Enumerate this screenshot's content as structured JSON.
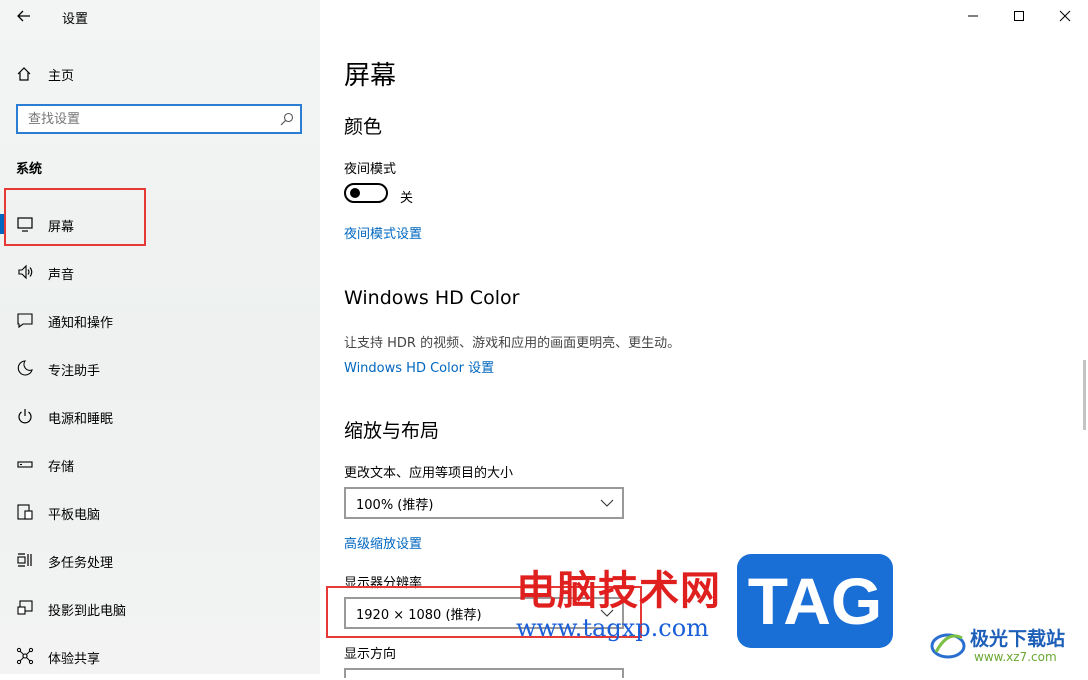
{
  "window": {
    "title": "设置"
  },
  "sidebar": {
    "home_label": "主页",
    "search_placeholder": "查找设置",
    "section": "系统",
    "items": [
      {
        "label": "屏幕",
        "icon": "monitor-icon"
      },
      {
        "label": "声音",
        "icon": "speaker-icon"
      },
      {
        "label": "通知和操作",
        "icon": "notification-icon"
      },
      {
        "label": "专注助手",
        "icon": "moon-icon"
      },
      {
        "label": "电源和睡眠",
        "icon": "power-icon"
      },
      {
        "label": "存储",
        "icon": "storage-icon"
      },
      {
        "label": "平板电脑",
        "icon": "tablet-icon"
      },
      {
        "label": "多任务处理",
        "icon": "multitask-icon"
      },
      {
        "label": "投影到此电脑",
        "icon": "project-icon"
      },
      {
        "label": "体验共享",
        "icon": "share-icon"
      }
    ]
  },
  "main": {
    "title": "屏幕",
    "color": {
      "heading": "颜色",
      "night_mode_label": "夜间模式",
      "night_mode_state": "关",
      "night_mode_settings_link": "夜间模式设置"
    },
    "hdr": {
      "heading": "Windows HD Color",
      "description": "让支持 HDR 的视频、游戏和应用的画面更明亮、更生动。",
      "link": "Windows HD Color 设置"
    },
    "scale": {
      "heading": "缩放与布局",
      "size_label": "更改文本、应用等项目的大小",
      "size_value": "100% (推荐)",
      "advanced_link": "高级缩放设置",
      "resolution_label": "显示器分辨率",
      "resolution_value": "1920 × 1080 (推荐)",
      "orientation_label": "显示方向"
    }
  },
  "watermarks": {
    "cn_text": "电脑技术网",
    "url": "www.tagxp.com",
    "tag": "TAG",
    "brand_name": "极光下载站",
    "brand_site": "www.xz7.com"
  },
  "colors": {
    "accent": "#0067c0",
    "highlight_box": "#e53935"
  }
}
